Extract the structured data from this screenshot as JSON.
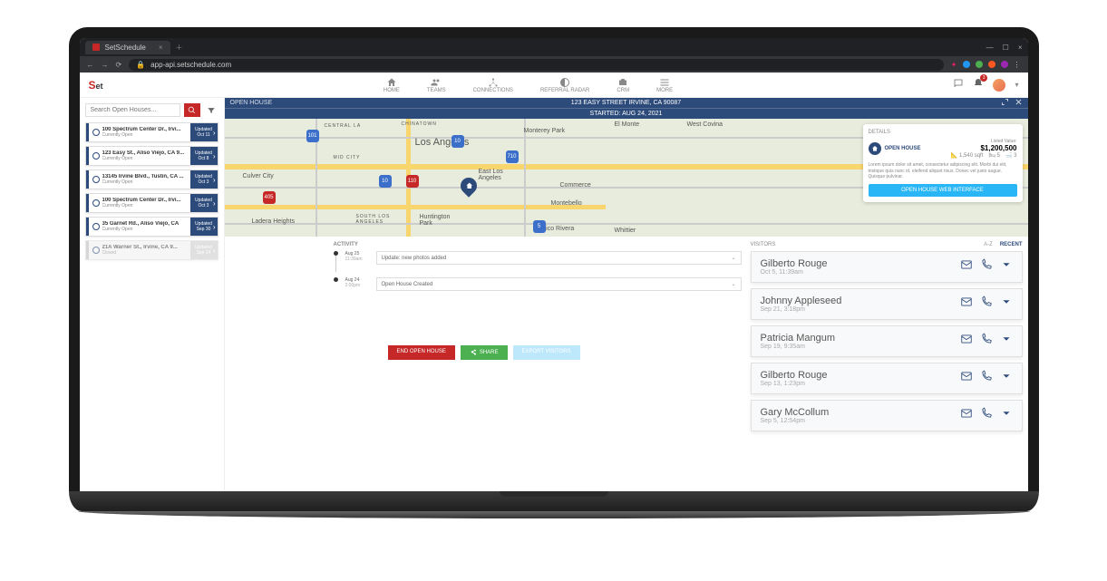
{
  "browser": {
    "tab_title": "SetSchedule",
    "url": "app-api.setschedule.com"
  },
  "nav": [
    {
      "label": "HOME"
    },
    {
      "label": "TEAMS"
    },
    {
      "label": "CONNECTIONS"
    },
    {
      "label": "REFERRAL RADAR"
    },
    {
      "label": "CRM"
    },
    {
      "label": "MORE"
    }
  ],
  "notif_count": "3",
  "search": {
    "placeholder": "Search Open Houses..."
  },
  "listings": [
    {
      "title": "100 Spectrum Center Dr., Irvi...",
      "sub": "Currently Open",
      "upd_lbl": "Updated",
      "upd_date": "Oct 11",
      "muted": false
    },
    {
      "title": "123 Easy St., Aliso Viejo, CA 9...",
      "sub": "Currently Open",
      "upd_lbl": "Updated",
      "upd_date": "Oct 8",
      "muted": false
    },
    {
      "title": "13145 Irvine Blvd., Tustin, CA ...",
      "sub": "Currently Open",
      "upd_lbl": "Updated",
      "upd_date": "Oct 3",
      "muted": false
    },
    {
      "title": "100 Spectrum Center Dr., Irvi...",
      "sub": "Currently Open",
      "upd_lbl": "Updated",
      "upd_date": "Oct 3",
      "muted": false
    },
    {
      "title": "35 Garnet Rd., Aliso Viejo, CA",
      "sub": "Currently Open",
      "upd_lbl": "Updated",
      "upd_date": "Sep 30",
      "muted": false
    },
    {
      "title": "21A Warner St., Irvine, CA 9...",
      "sub": "Closed",
      "upd_lbl": "Updated",
      "upd_date": "Sep 24",
      "muted": true
    }
  ],
  "titlebar": {
    "label": "OPEN HOUSE",
    "address": "123 EASY STREET IRVINE, CA 90087",
    "started": "STARTED: AUG 24, 2021"
  },
  "details": {
    "header": "DETAILS",
    "chip": "OPEN HOUSE",
    "listed_label": "Listed Value:",
    "price": "$1,200,500",
    "sqft": "1,540",
    "sqft_unit": "sqft",
    "beds": "5",
    "baths": "3",
    "lorem": "Lorem ipsum dolor sit amet, consectetur adipiscing elit. Morbi dui elit, tristique quis nunc id, eleifend aliquet risus. Donec vel justo augue. Quisque pulvinar.",
    "cta": "OPEN HOUSE WEB INTERFACE"
  },
  "map_labels": {
    "la": "Los Angeles",
    "ela": "East Los\nAngeles",
    "monterey": "Monterey Park",
    "elmonte": "El Monte",
    "wcovina": "West Covina",
    "pico": "Pico Rivera",
    "whittier": "Whittier",
    "culver": "Culver City",
    "ladera": "Ladera Heights",
    "huntington": "Huntington\nPark",
    "commerce": "Commerce",
    "montebello": "Montebello",
    "chinatown": "CHINATOWN",
    "centralla": "CENTRAL LA",
    "midcity": "MID CITY",
    "southla": "SOUTH LOS\nANGELES"
  },
  "activity": {
    "header": "ACTIVITY",
    "items": [
      {
        "date": "Aug 25",
        "time": "11:39am",
        "desc": "Update: new photos added"
      },
      {
        "date": "Aug 24",
        "time": "2:00pm",
        "desc": "Open House Created"
      }
    ]
  },
  "buttons": {
    "end": "END OPEN HOUSE",
    "share": "SHARE",
    "export": "EXPORT VISITORS"
  },
  "visitors": {
    "header": "VISITORS",
    "sort_az": "A-Z",
    "sort_recent": "RECENT",
    "items": [
      {
        "name": "Gilberto Rouge",
        "time": "Oct 5, 11:39am"
      },
      {
        "name": "Johnny Appleseed",
        "time": "Sep 21, 3:18pm"
      },
      {
        "name": "Patricia Mangum",
        "time": "Sep 19, 9:35am"
      },
      {
        "name": "Gilberto Rouge",
        "time": "Sep 13, 1:23pm"
      },
      {
        "name": "Gary McCollum",
        "time": "Sep 5, 12:54pm"
      }
    ]
  }
}
